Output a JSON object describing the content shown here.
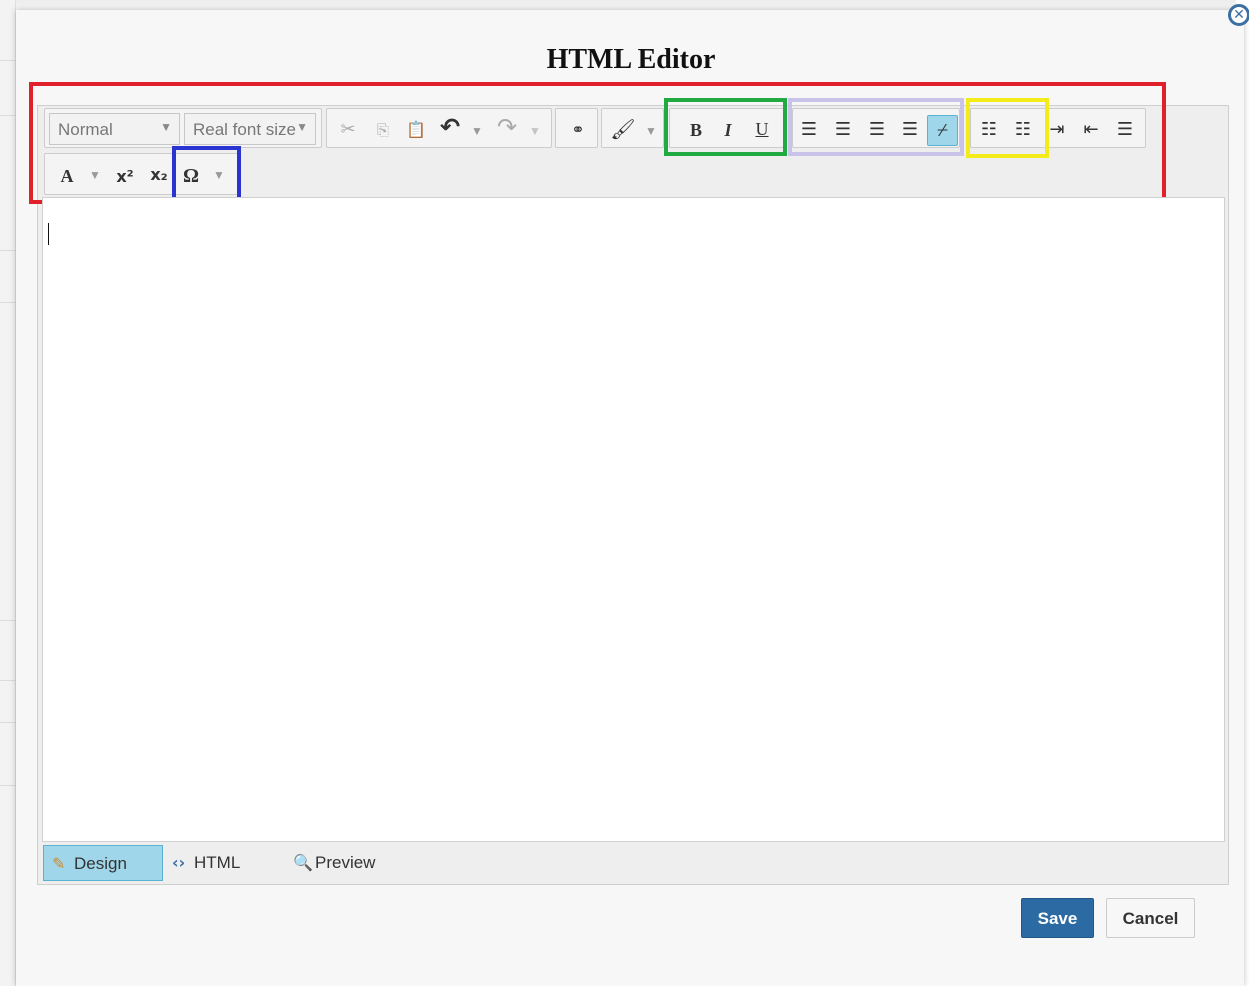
{
  "dialog": {
    "title": "HTML Editor"
  },
  "toolbar": {
    "format_select": "Normal",
    "font_size_select": "Real font size",
    "icons": {
      "cut": "cut-icon",
      "copy": "copy-icon",
      "paste": "paste-icon",
      "undo": "undo-icon",
      "redo": "redo-icon",
      "find": "find-icon",
      "format_painter": "format-painter-icon",
      "align_left": "align-left-icon",
      "align_center": "align-center-icon",
      "align_right": "align-right-icon",
      "justify": "justify-icon",
      "remove_alignment": "remove-alignment-icon",
      "ordered_list": "ordered-list-icon",
      "bullet_list": "bullet-list-icon",
      "indent": "indent-icon",
      "outdent": "outdent-icon",
      "paragraph": "paragraph-icon",
      "superscript": "superscript-icon",
      "subscript": "subscript-icon",
      "special_chars": "special-characters-icon"
    },
    "bold": "B",
    "italic": "I",
    "underline": "U",
    "forecolor": "A",
    "special_chars": "Ω"
  },
  "modes": {
    "design": "Design",
    "html": "HTML",
    "preview": "Preview"
  },
  "buttons": {
    "save": "Save",
    "cancel": "Cancel"
  },
  "colors": {
    "highlight_toolbar": "#e0202a",
    "highlight_basic_formatting": "#21a942",
    "highlight_alignment": "#c9c3ea",
    "highlight_lists": "#f3ec1a",
    "highlight_special_chars": "#2a35d1",
    "save_button": "#2b6aa2",
    "active_mode": "#9fd6ea"
  }
}
